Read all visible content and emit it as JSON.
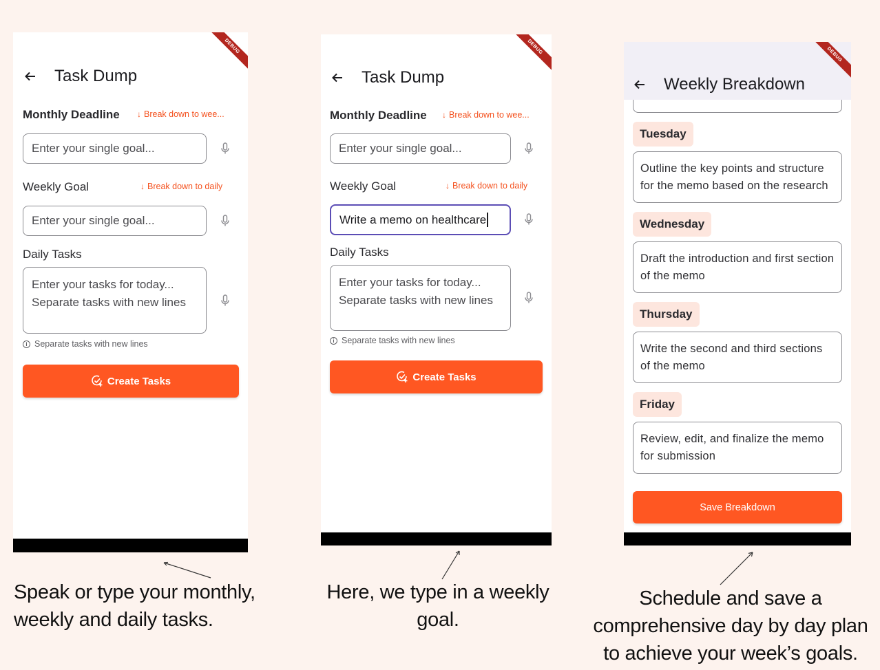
{
  "screens": [
    {
      "debug_label": "DEBUG",
      "title": "Task Dump",
      "monthly": {
        "label": "Monthly Deadline",
        "link": "Break down to wee...",
        "placeholder": "Enter your single goal..."
      },
      "weekly": {
        "label": "Weekly Goal",
        "link": "Break down to daily",
        "placeholder": "Enter your single goal..."
      },
      "daily": {
        "label": "Daily Tasks",
        "placeholder": "Enter your tasks for today...\nSeparate tasks with new lines",
        "helper": "Separate tasks with new lines"
      },
      "button": "Create Tasks"
    },
    {
      "debug_label": "DEBUG",
      "title": "Task Dump",
      "monthly": {
        "label": "Monthly Deadline",
        "link": "Break down to wee...",
        "placeholder": "Enter your single goal..."
      },
      "weekly": {
        "label": "Weekly Goal",
        "link": "Break down to daily",
        "value": "Write a memo on healthcare"
      },
      "daily": {
        "label": "Daily Tasks",
        "placeholder": "Enter your tasks for today...\nSeparate tasks with new lines",
        "helper": "Separate tasks with new lines"
      },
      "button": "Create Tasks"
    },
    {
      "debug_label": "DEBUG",
      "title": "Weekly Breakdown",
      "days": [
        {
          "day": "Tuesday",
          "task": "Outline the key points and structure for the memo based on the research"
        },
        {
          "day": "Wednesday",
          "task": "Draft the introduction and first section of the memo"
        },
        {
          "day": "Thursday",
          "task": "Write the second and third sections of the memo"
        },
        {
          "day": "Friday",
          "task": "Review, edit, and finalize the memo for submission"
        }
      ],
      "button": "Save Breakdown"
    }
  ],
  "captions": [
    "Speak or type your monthly, weekly and daily tasks.",
    "Here, we type in a weekly goal.",
    "Schedule and save a comprehensive day by day plan to achieve your week’s goals."
  ],
  "colors": {
    "background": "#fdf3ee",
    "accent": "#ff5722",
    "chip": "#fde6de",
    "focus": "#5b4db5"
  },
  "icons": {
    "back": "arrow-left-icon",
    "mic": "microphone-icon",
    "info": "info-icon",
    "task": "task-add-icon"
  }
}
